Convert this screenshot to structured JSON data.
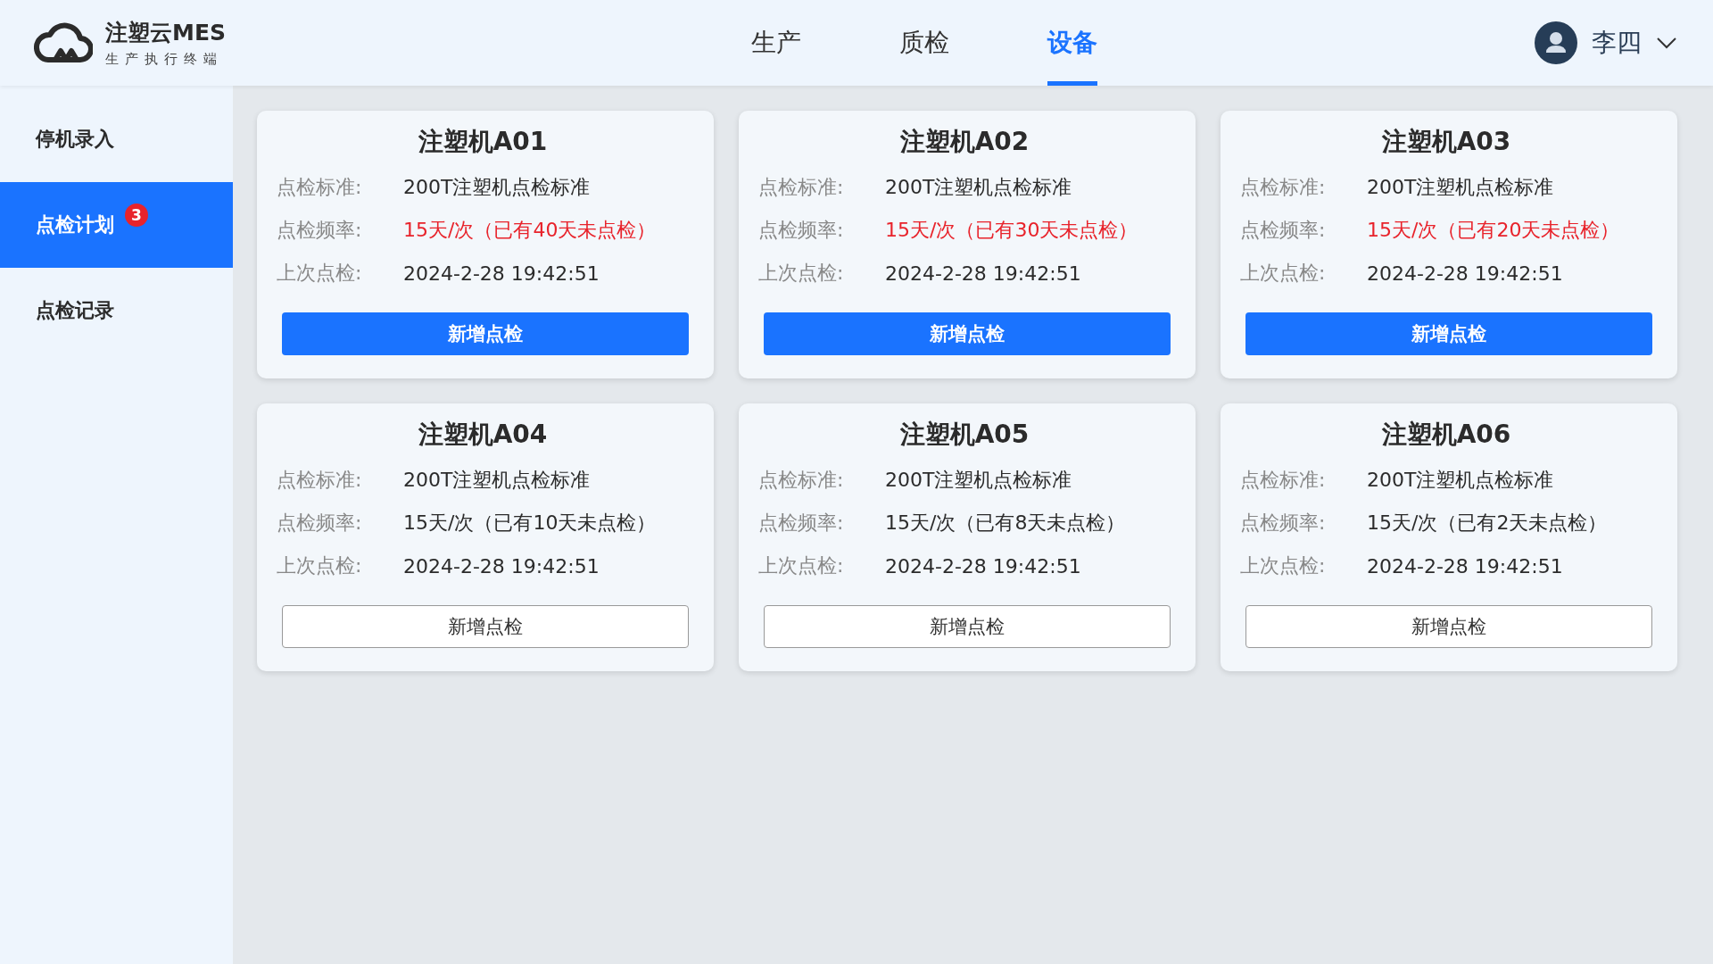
{
  "logo": {
    "title": "注塑云MES",
    "subtitle": "生产执行终端"
  },
  "nav_tabs": [
    {
      "label": "生产",
      "selected": false
    },
    {
      "label": "质检",
      "selected": false
    },
    {
      "label": "设备",
      "selected": true
    }
  ],
  "user": {
    "name": "李四"
  },
  "sidebar": {
    "items": [
      {
        "label": "停机录入",
        "selected": false
      },
      {
        "label": "点检计划",
        "selected": true,
        "badge": "3"
      },
      {
        "label": "点检记录",
        "selected": false
      }
    ]
  },
  "cards": [
    {
      "title": "注塑机A01",
      "fields": [
        {
          "label": "点检标准:",
          "value": "200T注塑机点检标准",
          "overdue": false
        },
        {
          "label": "点检频率:",
          "value": "15天/次（已有40天未点检）",
          "overdue": true
        },
        {
          "label": "上次点检:",
          "value": "2024-2-28 19:42:51",
          "overdue": false
        }
      ],
      "button": {
        "label": "新增点检",
        "primary": true
      }
    },
    {
      "title": "注塑机A02",
      "fields": [
        {
          "label": "点检标准:",
          "value": "200T注塑机点检标准",
          "overdue": false
        },
        {
          "label": "点检频率:",
          "value": "15天/次（已有30天未点检）",
          "overdue": true
        },
        {
          "label": "上次点检:",
          "value": "2024-2-28 19:42:51",
          "overdue": false
        }
      ],
      "button": {
        "label": "新增点检",
        "primary": true
      }
    },
    {
      "title": "注塑机A03",
      "fields": [
        {
          "label": "点检标准:",
          "value": "200T注塑机点检标准",
          "overdue": false
        },
        {
          "label": "点检频率:",
          "value": "15天/次（已有20天未点检）",
          "overdue": true
        },
        {
          "label": "上次点检:",
          "value": "2024-2-28 19:42:51",
          "overdue": false
        }
      ],
      "button": {
        "label": "新增点检",
        "primary": true
      }
    },
    {
      "title": "注塑机A04",
      "fields": [
        {
          "label": "点检标准:",
          "value": "200T注塑机点检标准",
          "overdue": false
        },
        {
          "label": "点检频率:",
          "value": "15天/次（已有10天未点检）",
          "overdue": false
        },
        {
          "label": "上次点检:",
          "value": "2024-2-28 19:42:51",
          "overdue": false
        }
      ],
      "button": {
        "label": "新增点检",
        "primary": false
      }
    },
    {
      "title": "注塑机A05",
      "fields": [
        {
          "label": "点检标准:",
          "value": "200T注塑机点检标准",
          "overdue": false
        },
        {
          "label": "点检频率:",
          "value": "15天/次（已有8天未点检）",
          "overdue": false
        },
        {
          "label": "上次点检:",
          "value": "2024-2-28 19:42:51",
          "overdue": false
        }
      ],
      "button": {
        "label": "新增点检",
        "primary": false
      }
    },
    {
      "title": "注塑机A06",
      "fields": [
        {
          "label": "点检标准:",
          "value": "200T注塑机点检标准",
          "overdue": false
        },
        {
          "label": "点检频率:",
          "value": "15天/次（已有2天未点检）",
          "overdue": false
        },
        {
          "label": "上次点检:",
          "value": "2024-2-28 19:42:51",
          "overdue": false
        }
      ],
      "button": {
        "label": "新增点检",
        "primary": false
      }
    }
  ]
}
